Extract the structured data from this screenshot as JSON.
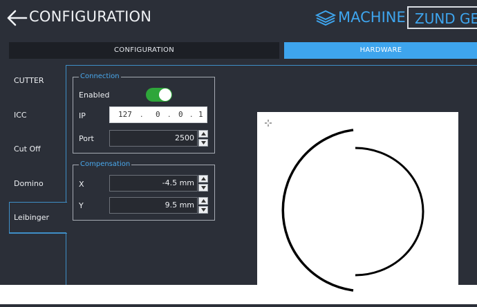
{
  "header": {
    "title": "CONFIGURATION",
    "machine_label": "MACHINE",
    "device_name": "ZUND GEN"
  },
  "tabs": [
    {
      "label": "CONFIGURATION",
      "active": false
    },
    {
      "label": "HARDWARE",
      "active": true
    }
  ],
  "sidebar": {
    "items": [
      {
        "label": "CUTTER"
      },
      {
        "label": "ICC"
      },
      {
        "label": "Cut Off"
      },
      {
        "label": "Domino"
      },
      {
        "label": "Leibinger",
        "active": true
      }
    ]
  },
  "connection": {
    "title": "Connection",
    "enabled_label": "Enabled",
    "enabled": true,
    "ip_label": "IP",
    "ip": [
      "127",
      "0",
      "0",
      "1"
    ],
    "port_label": "Port",
    "port": "2500"
  },
  "compensation": {
    "title": "Compensation",
    "x_label": "X",
    "x_value": "-4.5 mm",
    "y_label": "Y",
    "y_value": "9.5 mm"
  },
  "colors": {
    "accent": "#3ea5ee",
    "toggle_on": "#2ea63a",
    "background": "#2b2f38"
  },
  "icons": {
    "back": "arrow-left-icon",
    "machine": "machine-stack-icon",
    "cursor": "crosshair-icon",
    "spin_up": "triangle-up-icon",
    "spin_down": "triangle-down-icon"
  }
}
